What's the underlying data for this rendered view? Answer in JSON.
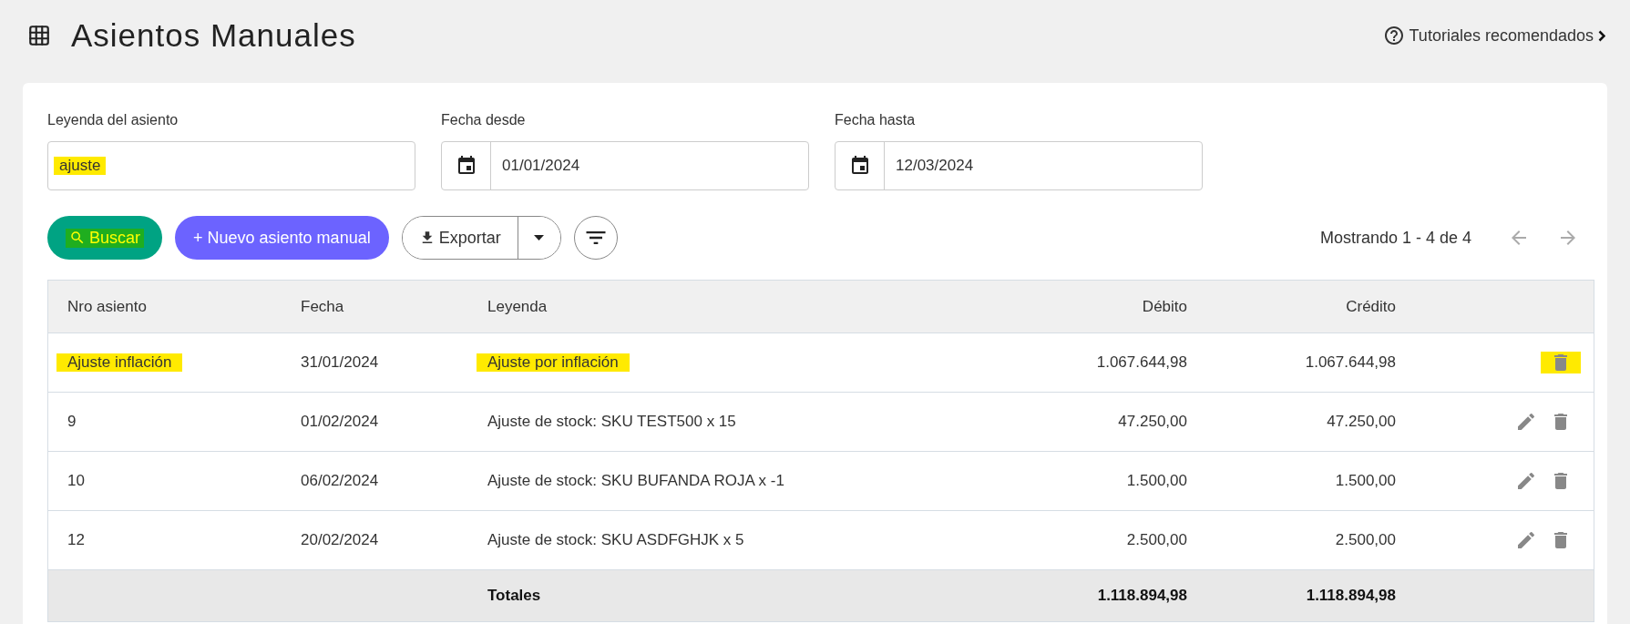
{
  "page": {
    "title": "Asientos Manuales",
    "help_link": "Tutoriales recomendados"
  },
  "filters": [
    {
      "kind": "text",
      "label": "Leyenda del asiento",
      "value": "ajuste",
      "highlighted": true
    },
    {
      "kind": "date",
      "label": "Fecha desde",
      "value": "01/01/2024",
      "highlighted": false
    },
    {
      "kind": "date",
      "label": "Fecha hasta",
      "value": "12/03/2024",
      "highlighted": false
    }
  ],
  "actions": {
    "search": {
      "label": "Buscar",
      "highlighted": true
    },
    "create": {
      "label": "+ Nuevo asiento manual"
    },
    "export": {
      "label": "Exportar"
    }
  },
  "pagination": {
    "label": "Mostrando 1 - 4 de 4",
    "prev_disabled": true,
    "next_disabled": true
  },
  "table": {
    "columns": [
      "Nro asiento",
      "Fecha",
      "Leyenda",
      "Débito",
      "Crédito"
    ],
    "rows": [
      {
        "nro": {
          "text": "Ajuste inflación",
          "highlighted": true
        },
        "fecha": "31/01/2024",
        "leyenda": {
          "text": "Ajuste por inflación",
          "highlighted": true
        },
        "debito": "1.067.644,98",
        "credito": "1.067.644,98",
        "editable": false,
        "delete_highlighted": true
      },
      {
        "nro": {
          "text": "9",
          "highlighted": false
        },
        "fecha": "01/02/2024",
        "leyenda": {
          "text": "Ajuste de stock: SKU TEST500 x 15",
          "highlighted": false
        },
        "debito": "47.250,00",
        "credito": "47.250,00",
        "editable": true,
        "delete_highlighted": false
      },
      {
        "nro": {
          "text": "10",
          "highlighted": false
        },
        "fecha": "06/02/2024",
        "leyenda": {
          "text": "Ajuste de stock: SKU BUFANDA ROJA x -1",
          "highlighted": false
        },
        "debito": "1.500,00",
        "credito": "1.500,00",
        "editable": true,
        "delete_highlighted": false
      },
      {
        "nro": {
          "text": "12",
          "highlighted": false
        },
        "fecha": "20/02/2024",
        "leyenda": {
          "text": "Ajuste de stock: SKU ASDFGHJK x 5",
          "highlighted": false
        },
        "debito": "2.500,00",
        "credito": "2.500,00",
        "editable": true,
        "delete_highlighted": false
      }
    ],
    "totals": {
      "label": "Totales",
      "debito": "1.118.894,98",
      "credito": "1.118.894,98"
    }
  }
}
